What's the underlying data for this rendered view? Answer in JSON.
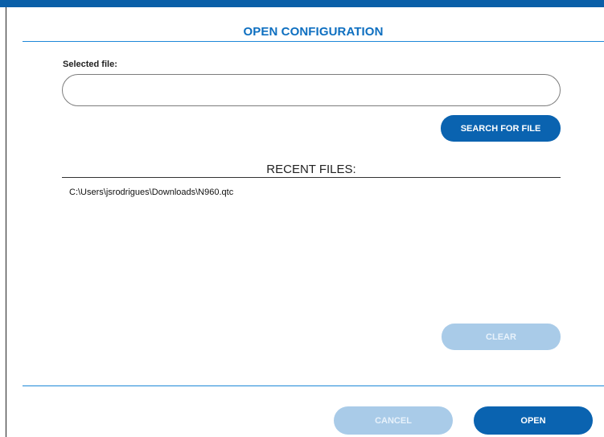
{
  "dialog": {
    "title": "OPEN CONFIGURATION"
  },
  "file": {
    "label": "Selected file:",
    "value": "",
    "placeholder": ""
  },
  "buttons": {
    "search": "SEARCH FOR FILE",
    "clear": "CLEAR",
    "cancel": "CANCEL",
    "open": "OPEN"
  },
  "recent": {
    "title": "RECENT FILES:",
    "items": [
      "C:\\Users\\jsrodrigues\\Downloads\\N960.qtc"
    ]
  },
  "colors": {
    "accent": "#0a63b0",
    "title": "#0e6fc0",
    "disabled_button": "#a9cbe8",
    "divider": "#1e88d8"
  }
}
